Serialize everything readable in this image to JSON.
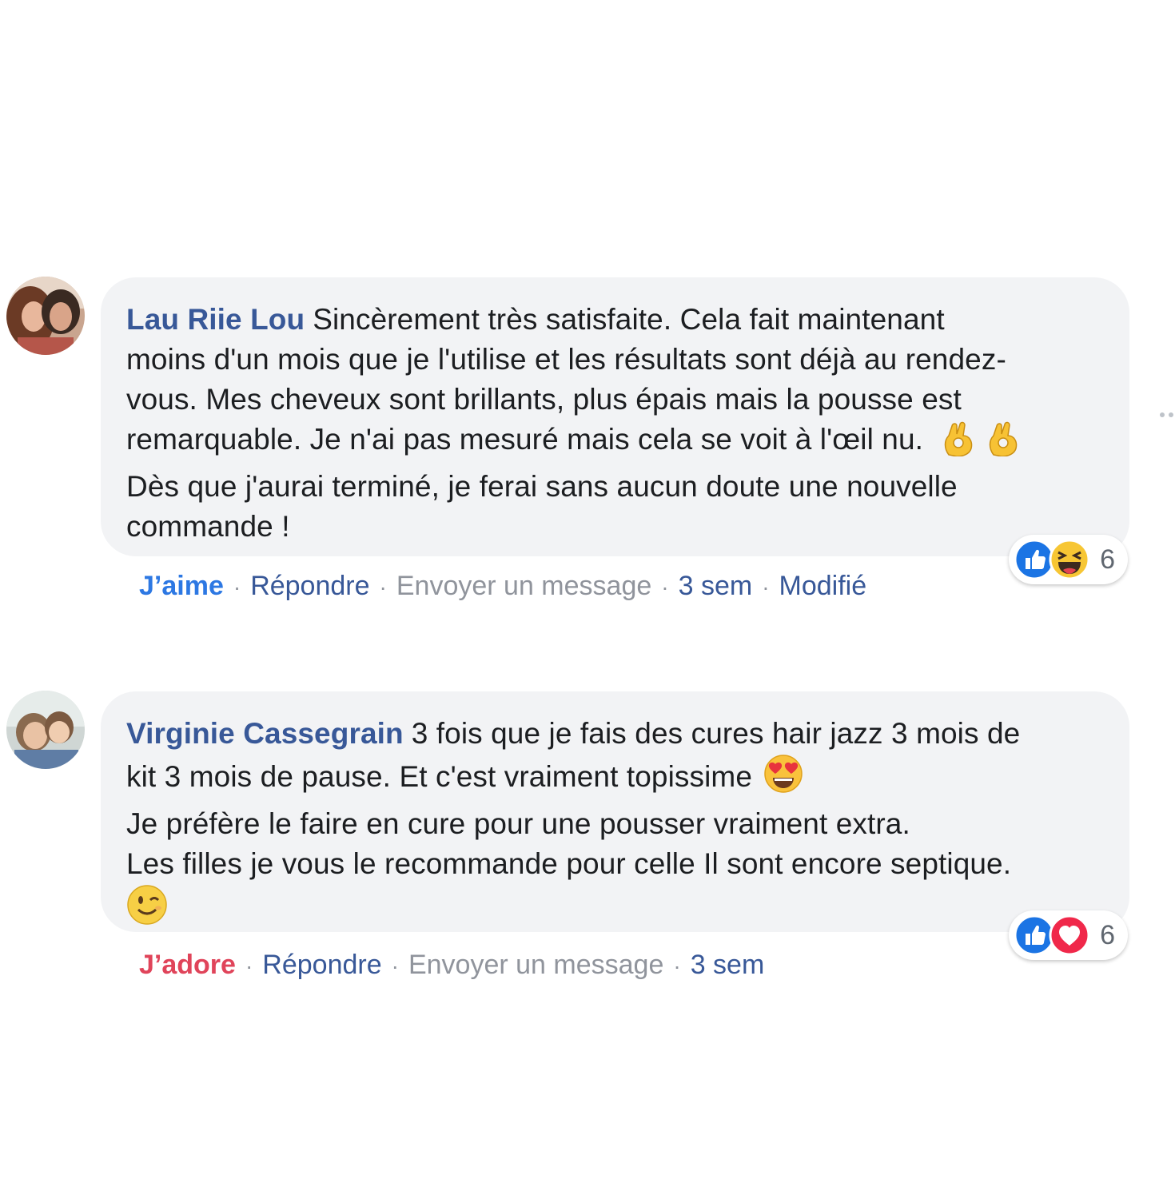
{
  "comments": [
    {
      "author": "Lau Riie Lou",
      "lines": [
        "Sincèrement très satisfaite. Cela fait maintenant",
        "moins d'un mois que je l'utilise et les résultats sont déjà au rendez-",
        "vous. Mes cheveux sont brillants, plus épais mais la pousse est",
        "remarquable. Je n'ai pas mesuré mais cela se voit à l'œil nu.",
        "Dès que j'aurai terminé, je ferai sans aucun doute une nouvelle",
        "commande !"
      ],
      "emojis": [
        "ok-hand-icon",
        "ok-hand-icon"
      ],
      "actions": {
        "reaction_label": "J’aime",
        "reply_label": "Répondre",
        "message_label": "Envoyer un message",
        "time": "3 sem",
        "edited": "Modifié"
      },
      "reactions": {
        "icons": [
          "like-icon",
          "haha-icon"
        ],
        "count": "6"
      }
    },
    {
      "author": "Virginie Cassegrain",
      "lines": [
        "3 fois que je fais des cures hair jazz 3 mois de",
        "kit 3 mois de pause. Et c'est vraiment topissime",
        "Je préfère le faire en cure pour une pousser vraiment extra.",
        "Les filles je vous le recommande pour celle Il sont encore septique."
      ],
      "emojis": [
        "heart-eyes-icon",
        "wink-icon"
      ],
      "actions": {
        "reaction_label": "J’adore",
        "reply_label": "Répondre",
        "message_label": "Envoyer un message",
        "time": "3 sem"
      },
      "reactions": {
        "icons": [
          "like-icon",
          "love-icon"
        ],
        "count": "6"
      }
    }
  ],
  "colors": {
    "author": "#385898",
    "like": "#2d78e3",
    "love": "#e0445a",
    "bubble": "#f2f3f5",
    "muted": "#90949c"
  }
}
